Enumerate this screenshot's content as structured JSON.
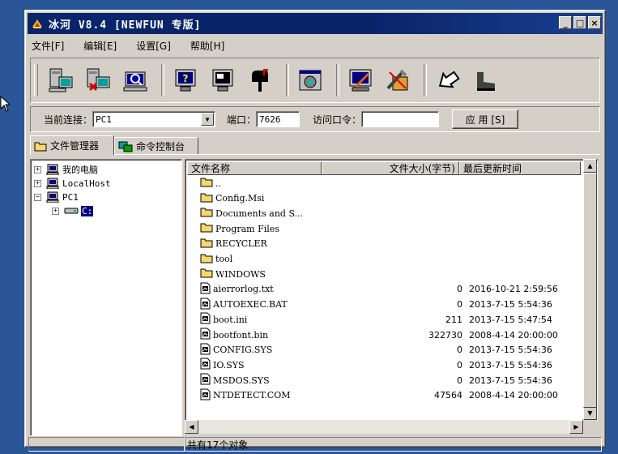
{
  "window": {
    "title": "冰河 V8.4 [NEWFUN 专版]"
  },
  "title_buttons": {
    "minimize": "_",
    "maximize": "□",
    "close": "×"
  },
  "menu": [
    {
      "label": "文件[F]"
    },
    {
      "label": "编辑[E]"
    },
    {
      "label": "设置[G]"
    },
    {
      "label": "帮助[H]"
    }
  ],
  "toolbar": {
    "icons": [
      "add-computer-icon",
      "delete-computer-icon",
      "search-computer-icon",
      "screen-info-icon",
      "screen-view-icon",
      "mailbox-icon",
      "control-panel-icon",
      "config-server-icon",
      "tools-icon",
      "go-back-icon",
      "walk-icon"
    ]
  },
  "connection": {
    "current_label": "当前连接：",
    "current_value": "PC1",
    "port_label": "端口：",
    "port_value": "7626",
    "password_label": "访问口令：",
    "password_value": "",
    "apply_button": "应 用 [S]"
  },
  "tabs": [
    {
      "label": "文件管理器"
    },
    {
      "label": "命令控制台"
    }
  ],
  "tree": {
    "items": [
      {
        "label": "我的电脑"
      },
      {
        "label": "LocalHost"
      },
      {
        "label": "PC1"
      },
      {
        "label": "C:"
      }
    ]
  },
  "list": {
    "columns": [
      "文件名称",
      "文件大小(字节)",
      "最后更新时间"
    ],
    "rows": [
      {
        "name": "..",
        "type": "folder",
        "size": "",
        "time": ""
      },
      {
        "name": "Config.Msi",
        "type": "folder",
        "size": "",
        "time": ""
      },
      {
        "name": "Documents and S...",
        "type": "folder",
        "size": "",
        "time": ""
      },
      {
        "name": "Program Files",
        "type": "folder",
        "size": "",
        "time": ""
      },
      {
        "name": "RECYCLER",
        "type": "folder",
        "size": "",
        "time": ""
      },
      {
        "name": "tool",
        "type": "folder",
        "size": "",
        "time": ""
      },
      {
        "name": "WINDOWS",
        "type": "folder",
        "size": "",
        "time": ""
      },
      {
        "name": "aierrorlog.txt",
        "type": "file",
        "size": "0",
        "time": "2016-10-21 2:59:56"
      },
      {
        "name": "AUTOEXEC.BAT",
        "type": "file",
        "size": "0",
        "time": "2013-7-15 5:54:36"
      },
      {
        "name": "boot.ini",
        "type": "file",
        "size": "211",
        "time": "2013-7-15 5:47:54"
      },
      {
        "name": "bootfont.bin",
        "type": "file",
        "size": "322730",
        "time": "2008-4-14 20:00:00"
      },
      {
        "name": "CONFIG.SYS",
        "type": "file",
        "size": "0",
        "time": "2013-7-15 5:54:36"
      },
      {
        "name": "IO.SYS",
        "type": "file",
        "size": "0",
        "time": "2013-7-15 5:54:36"
      },
      {
        "name": "MSDOS.SYS",
        "type": "file",
        "size": "0",
        "time": "2013-7-15 5:54:36"
      },
      {
        "name": "NTDETECT.COM",
        "type": "file",
        "size": "47564",
        "time": "2008-4-14 20:00:00"
      }
    ]
  },
  "status": {
    "left": "",
    "right": "共有17个对象"
  },
  "colors": {
    "desktop": "#2a5597",
    "titlebar": "#0a246a",
    "face": "#d4d0c8",
    "folder": "#f5d76e"
  }
}
